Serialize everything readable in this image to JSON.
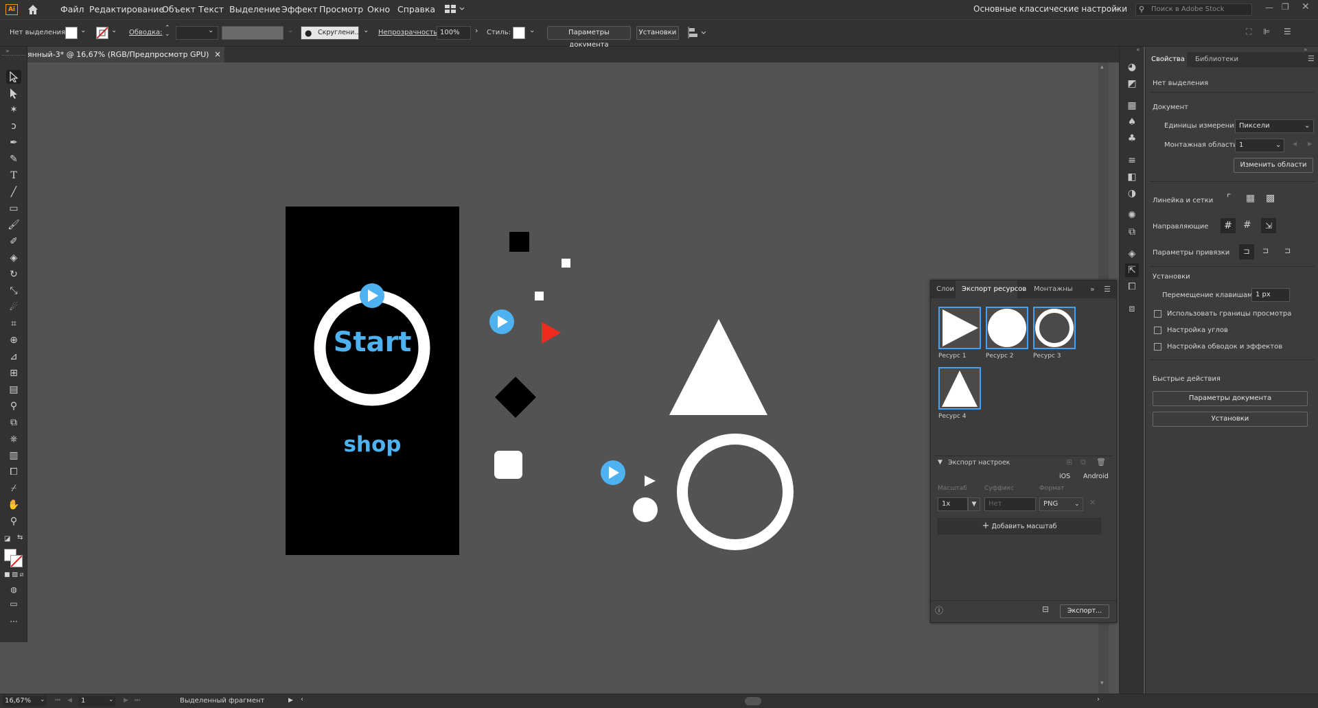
{
  "app": {
    "logo": "Ai",
    "menu": [
      "Файл",
      "Редактирование",
      "Объект",
      "Текст",
      "Выделение",
      "Эффект",
      "Просмотр",
      "Окно",
      "Справка"
    ],
    "workspace": "Основные классические настройки",
    "search_placeholder": "Поиск в Adobe Stock"
  },
  "control_bar": {
    "selection_status": "Нет выделения",
    "stroke_label": "Обводка:",
    "brush_label": "Скруглени...",
    "opacity_label": "Непрозрачность:",
    "opacity_value": "100%",
    "styles_label": "Стиль:",
    "doc_params_button": "Параметры документа",
    "settings_button": "Установки"
  },
  "document_tab": {
    "title": "янный-3* @ 16,67% (RGB/Предпросмотр GPU)",
    "close": "×"
  },
  "artboard": {
    "start_text": "Start",
    "shop_text": "shop"
  },
  "colors": {
    "accent_blue": "#4fb2f0",
    "red": "#ee2b1c",
    "canvas": "#535353",
    "panel": "#3c3c3c",
    "selection_blue": "#46a0f5"
  },
  "asset_panel": {
    "tabs": [
      "Слои",
      "Экспорт ресурсов",
      "Монтажны"
    ],
    "assets": [
      {
        "label": "Ресурс 1",
        "icon": "play-triangle-icon"
      },
      {
        "label": "Ресурс 2",
        "icon": "circle-icon"
      },
      {
        "label": "Ресурс 3",
        "icon": "ring-icon"
      },
      {
        "label": "Ресурс 4",
        "icon": "triangle-icon"
      }
    ],
    "export_settings_label": "Экспорт настроек",
    "ios": "iOS",
    "android": "Android",
    "scale_col": "Масштаб",
    "suffix_col": "Суффикс",
    "format_col": "Формат",
    "scale_value": "1x",
    "suffix_placeholder": "Нет",
    "format_value": "PNG",
    "add_scale_button": "Добавить масштаб",
    "export_button": "Экспорт..."
  },
  "properties": {
    "tabs": [
      "Свойства",
      "Библиотеки"
    ],
    "no_selection": "Нет выделения",
    "document_header": "Документ",
    "units_label": "Единицы измерения:",
    "units_value": "Пиксели",
    "artboard_label": "Монтажная область:",
    "artboard_value": "1",
    "edit_artboards_button": "Изменить области",
    "rulers_label": "Линейка и сетки",
    "guides_label": "Направляющие",
    "snap_label": "Параметры привязки",
    "preferences_header": "Установки",
    "keyboard_inc_label": "Перемещение клавишами:",
    "keyboard_inc_value": "1 px",
    "checkbox_1": "Использовать границы просмотра",
    "checkbox_2": "Настройка углов",
    "checkbox_3": "Настройка обводок и эффектов",
    "quick_actions_header": "Быстрые действия",
    "doc_params_button": "Параметры документа",
    "settings_button": "Установки"
  },
  "status_bar": {
    "zoom": "16,67%",
    "artboard_num": "1",
    "status_text": "Выделенный фрагмент"
  }
}
